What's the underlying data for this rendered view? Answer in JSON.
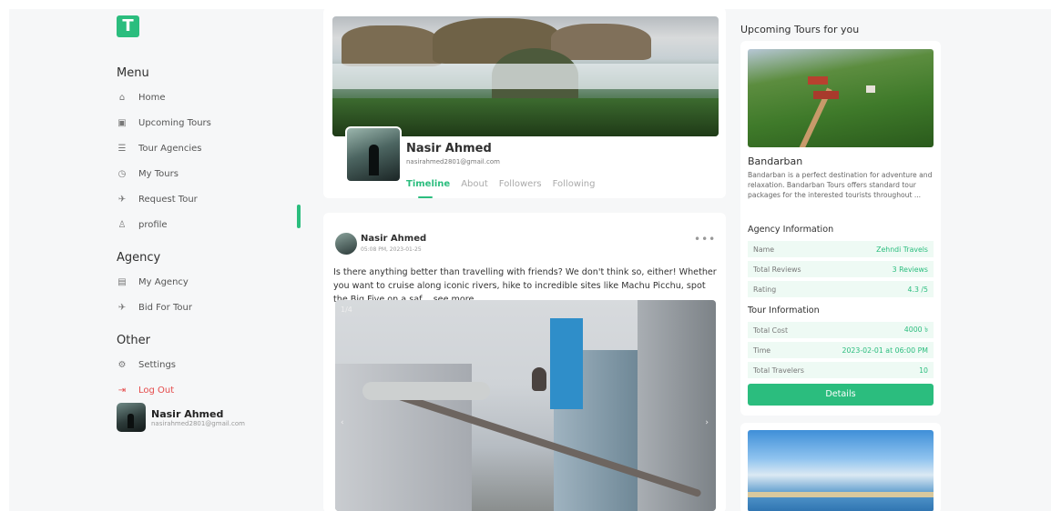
{
  "logo": {
    "letter": "T",
    "icon": "logo-icon"
  },
  "sidebar": {
    "menu_heading": "Menu",
    "menu_items": [
      {
        "label": "Home",
        "icon": "home-icon",
        "glyph": "⌂"
      },
      {
        "label": "Upcoming Tours",
        "icon": "calendar-icon",
        "glyph": "▣"
      },
      {
        "label": "Tour Agencies",
        "icon": "list-icon",
        "glyph": "☰"
      },
      {
        "label": "My Tours",
        "icon": "clock-icon",
        "glyph": "◷"
      },
      {
        "label": "Request Tour",
        "icon": "plane-icon",
        "glyph": "✈"
      },
      {
        "label": "profile",
        "icon": "user-icon",
        "glyph": "♙"
      }
    ],
    "agency_heading": "Agency",
    "agency_items": [
      {
        "label": "My Agency",
        "icon": "building-icon",
        "glyph": "▤"
      },
      {
        "label": "Bid For Tour",
        "icon": "plane-icon",
        "glyph": "✈"
      }
    ],
    "other_heading": "Other",
    "other_items": [
      {
        "label": "Settings",
        "icon": "gear-icon",
        "glyph": "⚙"
      },
      {
        "label": "Log Out",
        "icon": "logout-icon",
        "glyph": "⇥"
      }
    ],
    "user": {
      "name": "Nasir Ahmed",
      "email": "nasirahmed2801@gmail.com"
    }
  },
  "profile": {
    "name": "Nasir Ahmed",
    "email": "nasirahmed2801@gmail.com",
    "tabs": [
      "Timeline",
      "About",
      "Followers",
      "Following"
    ],
    "active_tab": "Timeline"
  },
  "post": {
    "author": "Nasir Ahmed",
    "time": "05:08 PM, 2023-01-25",
    "text": "Is there anything better than travelling with friends? We don't think so, either! Whether you want to cruise along iconic rivers, hike to incredible sites like Machu Picchu, spot the Big Five on a saf ...",
    "see_more": "see more",
    "image_counter": "1/4",
    "more_icon": "•••"
  },
  "right": {
    "title": "Upcoming Tours for you",
    "tour": {
      "name": "Bandarban",
      "description": "Bandarban is a perfect destination for adventure and relaxation. Bandarban Tours offers standard tour packages for the interested tourists throughout ...",
      "agency_heading": "Agency Information",
      "agency_rows": [
        {
          "key": "Name",
          "value": "Zehndi Travels"
        },
        {
          "key": "Total Reviews",
          "value": "3 Reviews"
        },
        {
          "key": "Rating",
          "value": "4.3 /5"
        }
      ],
      "tour_heading": "Tour Information",
      "tour_rows": [
        {
          "key": "Total Cost",
          "value": "4000 ৳"
        },
        {
          "key": "Time",
          "value": "2023-02-01 at 06:00 PM"
        },
        {
          "key": "Total Travelers",
          "value": "10"
        }
      ],
      "button": "Details"
    }
  },
  "colors": {
    "accent": "#2bbd7e",
    "logout": "#e54b4b",
    "background": "#f6f7f8"
  }
}
